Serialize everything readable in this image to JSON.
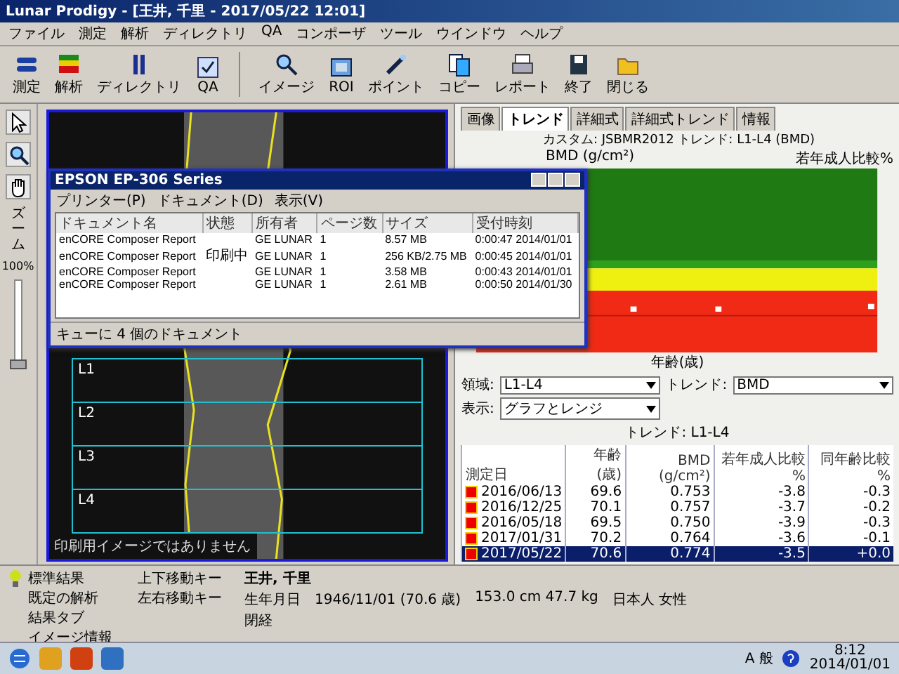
{
  "window": {
    "title": "Lunar Prodigy - [王井, 千里 - 2017/05/22 12:01]"
  },
  "menu": [
    "ファイル",
    "測定",
    "解析",
    "ディレクトリ",
    "QA",
    "コンポーザ",
    "ツール",
    "ウインドウ",
    "ヘルプ"
  ],
  "toolbar": [
    {
      "label": "測定",
      "kind": "measure"
    },
    {
      "label": "解析",
      "kind": "analyze"
    },
    {
      "label": "ディレクトリ",
      "kind": "directory"
    },
    {
      "label": "QA",
      "kind": "qa"
    },
    {
      "label": "イメージ",
      "kind": "image"
    },
    {
      "label": "ROI",
      "kind": "roi"
    },
    {
      "label": "ポイント",
      "kind": "point"
    },
    {
      "label": "コピー",
      "kind": "copy"
    },
    {
      "label": "レポート",
      "kind": "report"
    },
    {
      "label": "終了",
      "kind": "exit"
    },
    {
      "label": "閉じる",
      "kind": "close"
    }
  ],
  "tools": {
    "items": [
      {
        "kind": "arrow"
      },
      {
        "kind": "zoom"
      },
      {
        "kind": "hand"
      }
    ],
    "zoom_label": "ズーム",
    "zoom_value": "100%",
    "zoom_slider": {
      "level": 0
    }
  },
  "image": {
    "regions": [
      "L1",
      "L2",
      "L3",
      "L4"
    ],
    "notice": "印刷用イメージではありません"
  },
  "print_queue": {
    "title": "EPSON EP-306 Series",
    "menu": [
      "プリンター(P)",
      "ドキュメント(D)",
      "表示(V)"
    ],
    "columns": [
      "ドキュメント名",
      "状態",
      "所有者",
      "ページ数",
      "サイズ",
      "受付時刻"
    ],
    "rows": [
      [
        "enCORE Composer Report",
        "",
        "GE LUNAR",
        "1",
        "8.57 MB",
        "0:00:47 2014/01/01"
      ],
      [
        "enCORE Composer Report",
        "印刷中",
        "GE LUNAR",
        "1",
        "256 KB/2.75 MB",
        "0:00:45 2014/01/01"
      ],
      [
        "enCORE Composer Report",
        "",
        "GE LUNAR",
        "1",
        "3.58 MB",
        "0:00:43 2014/01/01"
      ],
      [
        "enCORE Composer Report",
        "",
        "GE LUNAR",
        "1",
        "2.61 MB",
        "0:00:50 2014/01/30"
      ]
    ],
    "status": "キューに 4 個のドキュメント"
  },
  "tabs": [
    {
      "label": "画像",
      "selected": false
    },
    {
      "label": "トレンド",
      "selected": true
    },
    {
      "label": "詳細式",
      "selected": false
    },
    {
      "label": "詳細式トレンド",
      "selected": false
    },
    {
      "label": "情報",
      "selected": false
    }
  ],
  "trend": {
    "title": "カスタム: JSBMR2012 トレンド: L1-L4 (BMD)",
    "ylabel": "BMD (g/cm²)",
    "y2label": "若年成人比較%",
    "xlabel": "年齢(歳)"
  },
  "selectors": [
    {
      "label": "領域:",
      "value": "L1-L4"
    },
    {
      "label": "トレンド:",
      "value": "BMD"
    },
    {
      "label": "表示:",
      "value": "グラフとレンジ"
    }
  ],
  "trend_table": {
    "caption": "トレンド: L1-L4",
    "columns": [
      "測定日",
      "年齢 (歳)",
      "BMD (g/cm²)",
      "若年成人比較 %",
      "同年齢比較 %"
    ],
    "rows": [
      {
        "cells": [
          "2016/06/13",
          "69.6",
          "0.753",
          "-3.8",
          "-0.3"
        ],
        "selected": false
      },
      {
        "cells": [
          "2016/12/25",
          "70.1",
          "0.757",
          "-3.7",
          "-0.2"
        ],
        "selected": false
      },
      {
        "cells": [
          "2016/05/18",
          "69.5",
          "0.750",
          "-3.9",
          "-0.3"
        ],
        "selected": false
      },
      {
        "cells": [
          "2017/01/31",
          "70.2",
          "0.764",
          "-3.6",
          "-0.1"
        ],
        "selected": false
      },
      {
        "cells": [
          "2017/05/22",
          "70.6",
          "0.774",
          "-3.5",
          "+0.0"
        ],
        "selected": true
      }
    ]
  },
  "patient": {
    "name": "王井, 千里",
    "birth_label": "生年月日",
    "birth": "1946/11/01 (70.6 歳)",
    "body": "153.0 cm 47.7 kg",
    "ethnicity": "日本人 女性",
    "note": "閉経"
  },
  "status_bar": {
    "left": [
      "標準結果",
      "既定の解析",
      "結果タブ",
      "イメージ情報"
    ],
    "right": [
      "上下移動キー",
      "左右移動キー"
    ]
  },
  "taskbar": {
    "ime": "A 般",
    "time": "8:12",
    "date": "2014/01/01"
  }
}
